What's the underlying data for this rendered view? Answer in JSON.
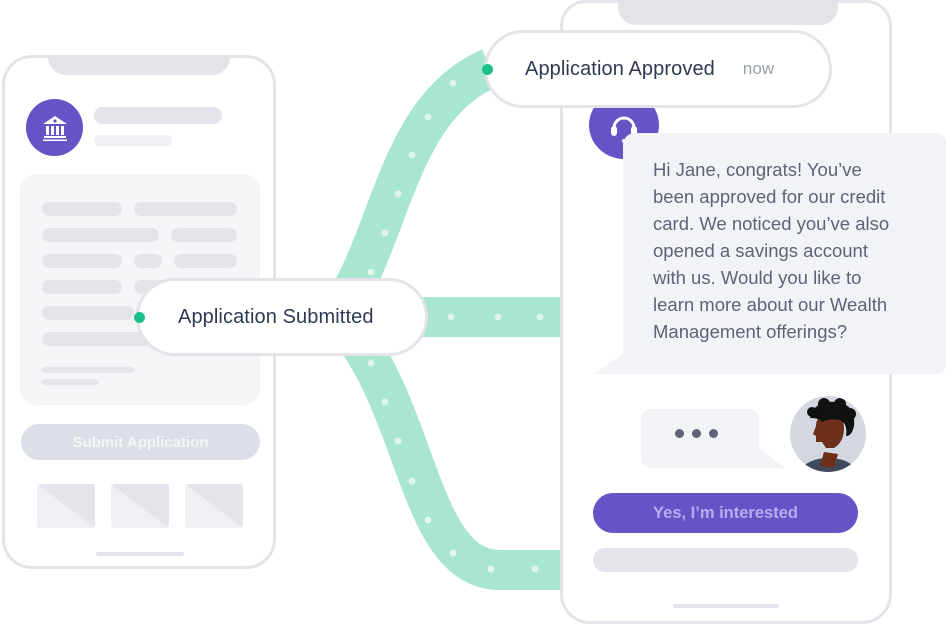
{
  "colors": {
    "brand_purple": "#6653c6",
    "path_green": "#a8e6d0",
    "node_green": "#1fbf8a",
    "phone_border": "#e2e4ea",
    "skeleton": "#e3e5eb",
    "text_dark": "#2f3a52",
    "text_muted": "#9aa0ad"
  },
  "left_phone": {
    "avatar_icon": "bank-icon",
    "submit_button_label": "Submit Application",
    "thumbnail_count": 3
  },
  "nodes": {
    "submitted": {
      "label": "Application Submitted"
    },
    "approved": {
      "label": "Application Approved",
      "time": "now"
    }
  },
  "right_phone": {
    "agent_icon": "headset-icon",
    "message_lines": [
      "Hi Jane, congrats! You’ve",
      "been approved for our credit",
      "card. We noticed you’ve also",
      "opened a savings account",
      "with us. Would you like to",
      "learn more about our Wealth",
      "Management offerings?"
    ],
    "typing_indicator": "•••",
    "user_avatar": "user-avatar",
    "cta_button_label": "Yes, I’m interested"
  }
}
